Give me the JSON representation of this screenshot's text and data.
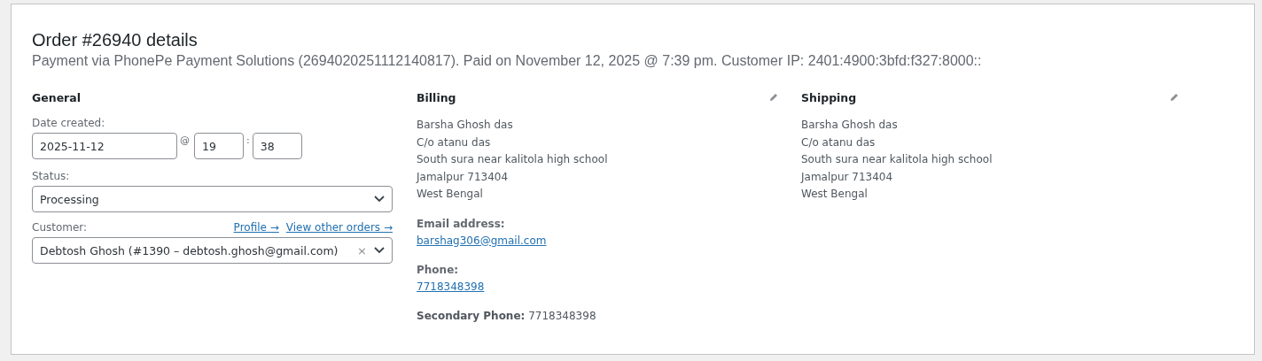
{
  "title": "Order #26940 details",
  "subtitle": "Payment via PhonePe Payment Solutions (2694020251112140817). Paid on November 12, 2025 @ 7:39 pm. Customer IP: 2401:4900:3bfd:f327:8000::",
  "general": {
    "heading": "General",
    "date_label": "Date created:",
    "date": "2025-11-12",
    "at": "@",
    "hour": "19",
    "colon": ":",
    "minute": "38",
    "status_label": "Status:",
    "status": "Processing",
    "customer_label": "Customer:",
    "links": [
      "Profile →",
      "View other orders →"
    ],
    "customer": "Debtosh Ghosh (#1390 – debtosh.ghosh@gmail.com)",
    "clear": "×"
  },
  "billing": {
    "heading": "Billing",
    "address": [
      "Barsha Ghosh das",
      "C/o atanu das",
      "South sura near kalitola high school",
      "Jamalpur 713404",
      "West Bengal"
    ],
    "fields": [
      {
        "kind": "link",
        "label": "Email address:",
        "value": "barshag306@gmail.com"
      },
      {
        "kind": "link",
        "label": "Phone:",
        "value": "7718348398"
      },
      {
        "kind": "inline",
        "text": "**Secondary Phone:** 7718348398"
      }
    ]
  },
  "shipping": {
    "heading": "Shipping",
    "address": [
      "Barsha Ghosh das",
      "C/o atanu das",
      "South sura near kalitola high school",
      "Jamalpur 713404",
      "West Bengal"
    ]
  }
}
